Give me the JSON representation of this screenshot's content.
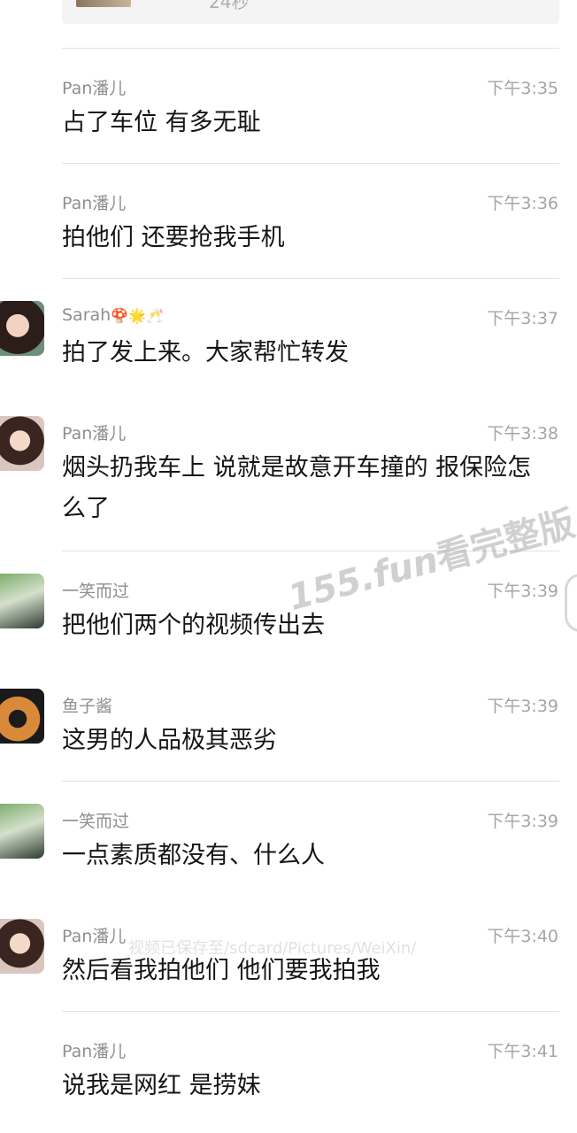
{
  "top_card": {
    "duration": "24秒"
  },
  "messages": [
    {
      "name": "Pan潘儿",
      "time": "下午3:35",
      "text": "占了车位 有多无耻"
    },
    {
      "name": "Pan潘儿",
      "time": "下午3:36",
      "text": "拍他们 还要抢我手机"
    },
    {
      "name": "Sarah",
      "name_emoji": "🍄🌟🥂",
      "time": "下午3:37",
      "text": "拍了发上来。大家帮忙转发"
    },
    {
      "name": "Pan潘儿",
      "time": "下午3:38",
      "text": "烟头扔我车上 说就是故意开车撞的 报保险怎么了"
    },
    {
      "name": "一笑而过",
      "time": "下午3:39",
      "text": "把他们两个的视频传出去"
    },
    {
      "name": "鱼子酱",
      "time": "下午3:39",
      "text": "这男的人品极其恶劣"
    },
    {
      "name": "一笑而过",
      "time": "下午3:39",
      "text": "一点素质都没有、什么人"
    },
    {
      "name": "Pan潘儿",
      "time": "下午3:40",
      "text": "然后看我拍他们 他们要我拍我"
    },
    {
      "name": "Pan潘儿",
      "time": "下午3:41",
      "text": "说我是网红 是捞妹"
    }
  ],
  "watermark": {
    "site": "155.fun",
    "suffix": "看完整版"
  },
  "toast": "视频已保存至/sdcard/Pictures/WeiXin/",
  "colors": {
    "separator": "#e3e3e3",
    "name": "#8f8f8f",
    "time": "#a5a5a5",
    "text": "#151515"
  }
}
